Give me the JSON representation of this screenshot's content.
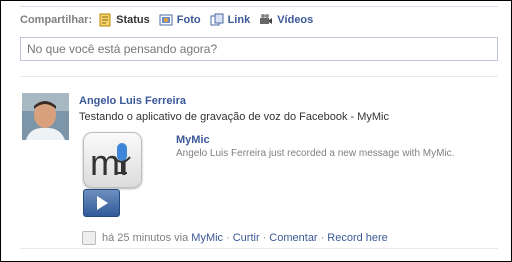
{
  "share": {
    "label": "Compartilhar:",
    "items": [
      {
        "label": "Status",
        "icon": "status-icon"
      },
      {
        "label": "Foto",
        "icon": "photo-icon"
      },
      {
        "label": "Link",
        "icon": "link-icon"
      },
      {
        "label": "Vídeos",
        "icon": "video-icon"
      }
    ]
  },
  "status_input": {
    "placeholder": "No que você está pensando agora?"
  },
  "post": {
    "author": "Angelo Luis Ferreira",
    "message": "Testando o aplicativo de gravação de voz do Facebook - MyMic",
    "attachment": {
      "app_name": "MyMic",
      "description": "Angelo Luis Ferreira just recorded a new message with MyMic.",
      "logo_text": "mi"
    },
    "meta": {
      "time": "há 25 minutos via",
      "via_app": "MyMic",
      "actions": [
        "Curtir",
        "Comentar",
        "Record here"
      ],
      "separator": "·"
    }
  },
  "colors": {
    "link": "#3b5998",
    "muted": "#808080",
    "border": "#bdc7d8"
  }
}
